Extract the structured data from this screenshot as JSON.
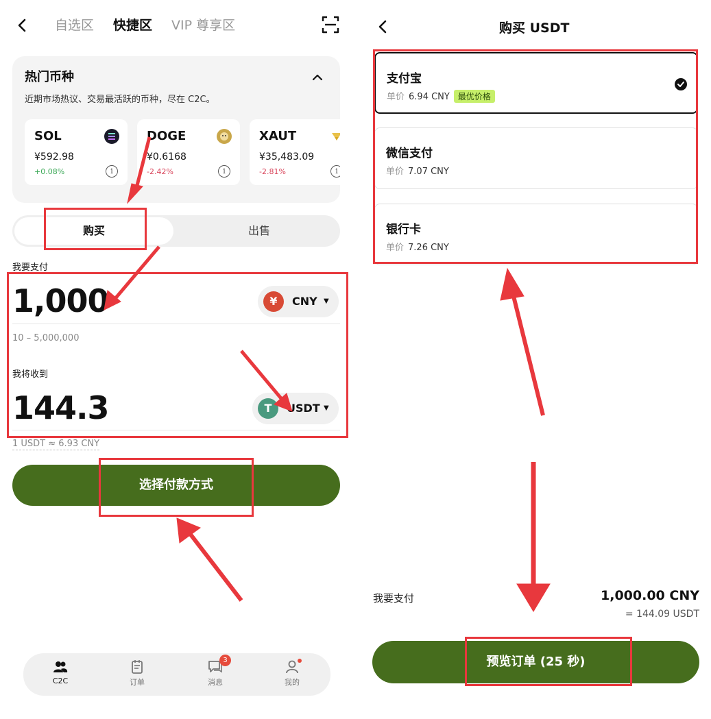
{
  "left": {
    "top_tabs": [
      "自选区",
      "快捷区",
      "VIP 尊享区"
    ],
    "hot": {
      "title": "热门币种",
      "desc": "近期市场热议、交易最活跃的币种，尽在 C2C。",
      "coins": [
        {
          "symbol": "SOL",
          "price": "¥592.98",
          "change": "+0.08%",
          "change_color": "#3aa856",
          "logo_color": "#222"
        },
        {
          "symbol": "DOGE",
          "price": "¥0.6168",
          "change": "-2.42%",
          "change_color": "#d9455b",
          "logo_color": "#c9a74a"
        },
        {
          "symbol": "XAUT",
          "price": "¥35,483.09",
          "change": "-2.81%",
          "change_color": "#d9455b",
          "logo_color": "#e9c14a"
        }
      ]
    },
    "segment": {
      "buy": "购买",
      "sell": "出售"
    },
    "pay_label": "我要支付",
    "pay_amount": "1,000",
    "pay_currency": "CNY",
    "pay_currency_glyph": "¥",
    "range": "10 – 5,000,000",
    "receive_label": "我将收到",
    "receive_amount": "144.3",
    "receive_currency": "USDT",
    "receive_currency_glyph": "T",
    "rate_note": "1 USDT ≈ 6.93 CNY",
    "cta": "选择付款方式",
    "nav": [
      {
        "label": "C2C",
        "icon": "people-icon"
      },
      {
        "label": "订单",
        "icon": "orders-icon"
      },
      {
        "label": "消息",
        "icon": "message-icon",
        "badge": "3"
      },
      {
        "label": "我的",
        "icon": "profile-icon"
      }
    ]
  },
  "right": {
    "title": "购买 USDT",
    "unit_label": "单价",
    "methods": [
      {
        "name": "支付宝",
        "price": "6.94 CNY",
        "tag": "最优价格",
        "selected": true
      },
      {
        "name": "微信支付",
        "price": "7.07 CNY"
      },
      {
        "name": "银行卡",
        "price": "7.26 CNY"
      }
    ],
    "pay_label": "我要支付",
    "pay_amount": "1,000.00 CNY",
    "pay_equiv": "= 144.09 USDT",
    "cta": "预览订单 (25 秒)"
  },
  "colors": {
    "brand_green": "#466d1d",
    "annotation_red": "#e8383d",
    "best_tag": "#c6ef6a"
  }
}
